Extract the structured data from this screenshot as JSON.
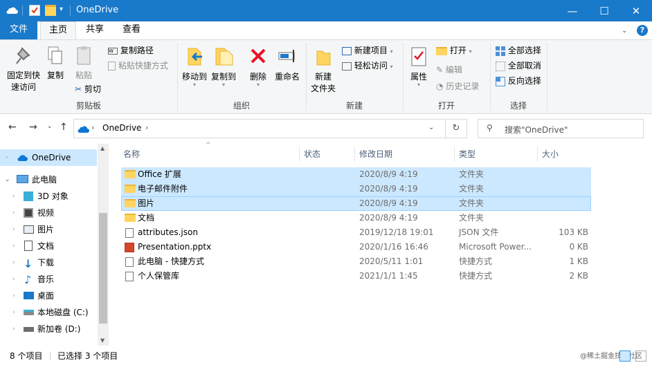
{
  "window": {
    "title": "OneDrive",
    "minimize": "—",
    "maximize": "☐",
    "close": "✕"
  },
  "ribbon_tabs": [
    "文件",
    "主页",
    "共享",
    "查看"
  ],
  "help": "?",
  "ribbon": {
    "clipboard": {
      "pin": "固定到快\n速访问",
      "copy": "复制",
      "paste": "粘贴",
      "copy_path": "复制路径",
      "paste_shortcut": "粘贴快捷方式",
      "cut": "剪切",
      "label": "剪贴板"
    },
    "organize": {
      "move_to": "移动到",
      "copy_to": "复制到",
      "delete": "删除",
      "rename": "重命名",
      "label": "组织"
    },
    "new": {
      "new_folder": "新建\n文件夹",
      "new_item": "新建项目",
      "easy_access": "轻松访问",
      "label": "新建"
    },
    "open": {
      "properties": "属性",
      "open": "打开",
      "edit": "编辑",
      "history": "历史记录",
      "label": "打开"
    },
    "select": {
      "select_all": "全部选择",
      "select_none": "全部取消",
      "invert": "反向选择",
      "label": "选择"
    }
  },
  "address": {
    "path": "OneDrive",
    "search_placeholder": "搜索\"OneDrive\""
  },
  "nav": [
    "OneDrive",
    "此电脑",
    "3D 对象",
    "视频",
    "图片",
    "文档",
    "下载",
    "音乐",
    "桌面",
    "本地磁盘 (C:)",
    "新加卷 (D:)"
  ],
  "columns": {
    "name": "名称",
    "status": "状态",
    "date": "修改日期",
    "type": "类型",
    "size": "大小"
  },
  "files": [
    {
      "name": "Office 扩展",
      "date": "2020/8/9 4:19",
      "type": "文件夹",
      "size": ""
    },
    {
      "name": "电子邮件附件",
      "date": "2020/8/9 4:19",
      "type": "文件夹",
      "size": ""
    },
    {
      "name": "图片",
      "date": "2020/8/9 4:19",
      "type": "文件夹",
      "size": ""
    },
    {
      "name": "文档",
      "date": "2020/8/9 4:19",
      "type": "文件夹",
      "size": ""
    },
    {
      "name": "attributes.json",
      "date": "2019/12/18 19:01",
      "type": "JSON 文件",
      "size": "103 KB"
    },
    {
      "name": "Presentation.pptx",
      "date": "2020/1/16 16:46",
      "type": "Microsoft Power...",
      "size": "0 KB"
    },
    {
      "name": "此电脑 - 快捷方式",
      "date": "2020/5/11 1:01",
      "type": "快捷方式",
      "size": "1 KB"
    },
    {
      "name": "个人保管库",
      "date": "2021/1/1 1:45",
      "type": "快捷方式",
      "size": "2 KB"
    }
  ],
  "status": {
    "count": "8 个项目",
    "selected": "已选择 3 个项目"
  },
  "watermark": "@稀土掘金技术社区",
  "colors": {
    "accent": "#1979ca",
    "selection": "#cce8ff",
    "delete_red": "#e81123"
  }
}
